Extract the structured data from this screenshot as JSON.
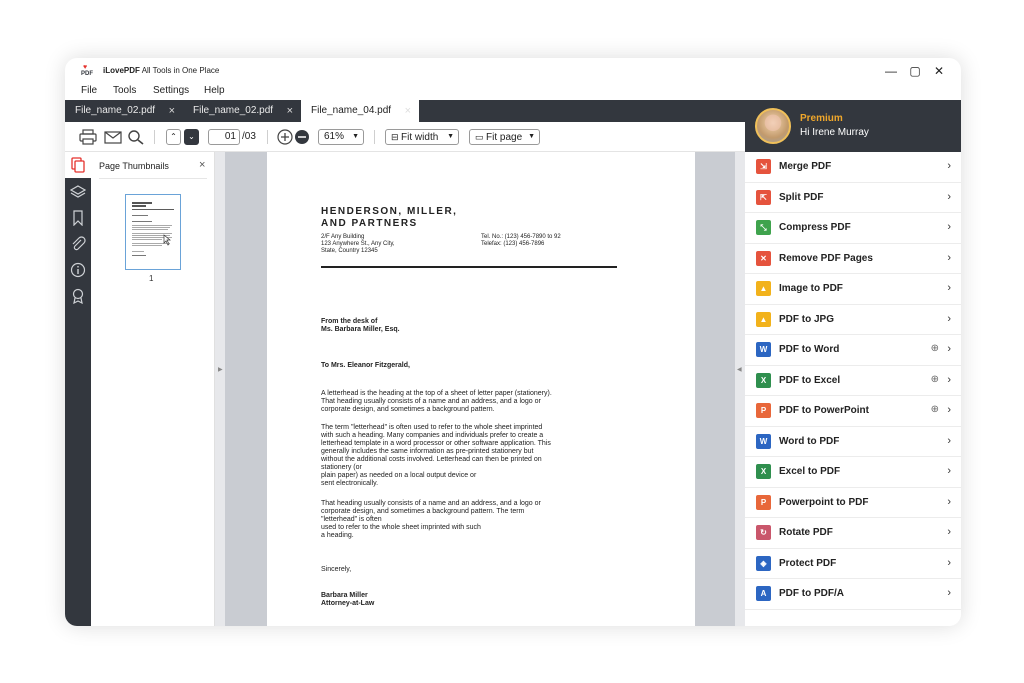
{
  "app": {
    "title_brand": "iLovePDF",
    "title_rest": " All Tools in One Place",
    "logo_text": "PDF"
  },
  "window": {
    "minimize": "—",
    "maximize": "▢",
    "close": "✕"
  },
  "menu": [
    "File",
    "Tools",
    "Settings",
    "Help"
  ],
  "tabs": [
    {
      "label": "File_name_02.pdf",
      "close": "×"
    },
    {
      "label": "File_name_02.pdf",
      "close": "×"
    },
    {
      "label": "File_name_04.pdf",
      "close": "×"
    }
  ],
  "toolbar": {
    "page_current": "01",
    "page_total": "/03",
    "zoom": "61%",
    "fit_width": "Fit width",
    "fit_page": "Fit page"
  },
  "thumbnails": {
    "title": "Page Thumbnails",
    "close": "×",
    "page_num": "1"
  },
  "document": {
    "company": "HENDERSON, MILLER,\nAND PARTNERS",
    "address": "2/F Any Building\n123 Anywhere St., Any City,\nState, Country 12345",
    "contact": "Tel. No.: (123) 456-7890 to 92\nTelefax: (123) 456-7896",
    "from": "From the desk of\nMs. Barbara Miller, Esq.",
    "to": "To Mrs. Eleanor Fitzgerald,",
    "p1": "A letterhead is the heading at the top of a sheet of letter paper (stationery).\nThat heading usually consists of a name and an address, and a logo or\ncorporate design, and sometimes a background pattern.",
    "p2": "The term \"letterhead\" is often used to refer to the whole sheet imprinted\nwith such a heading. Many companies and individuals prefer to create a\nletterhead template in a word processor or other software application. This\ngenerally includes the same information as pre-printed stationery but\nwithout the additional costs involved. Letterhead can then be printed on\nstationery (or\nplain paper) as needed on a local output device or\nsent electronically.",
    "p3": "That heading usually consists of a name and an address, and a logo or\ncorporate design, and sometimes a background pattern. The term\n\"letterhead\" is often\nused to refer to the whole sheet imprinted with such\na heading.",
    "closing": "Sincerely,",
    "signer": "Barbara Miller\nAttorney-at-Law"
  },
  "user": {
    "tier": "Premium",
    "greeting": "Hi Irene Murray"
  },
  "tools": [
    {
      "label": "Merge PDF",
      "color": "#e5533d",
      "glyph": "⇲",
      "globe": false
    },
    {
      "label": "Split PDF",
      "color": "#e5533d",
      "glyph": "⇱",
      "globe": false
    },
    {
      "label": "Compress PDF",
      "color": "#3fa34d",
      "glyph": "⤡",
      "globe": false
    },
    {
      "label": "Remove PDF Pages",
      "color": "#e5533d",
      "glyph": "✕",
      "globe": false
    },
    {
      "label": "Image to PDF",
      "color": "#f2b21b",
      "glyph": "▲",
      "globe": false
    },
    {
      "label": "PDF to JPG",
      "color": "#f2b21b",
      "glyph": "▲",
      "globe": false
    },
    {
      "label": "PDF to Word",
      "color": "#2c66c2",
      "glyph": "W",
      "globe": true
    },
    {
      "label": "PDF to Excel",
      "color": "#2f8f4e",
      "glyph": "X",
      "globe": true
    },
    {
      "label": "PDF to PowerPoint",
      "color": "#e8673a",
      "glyph": "P",
      "globe": true
    },
    {
      "label": "Word to PDF",
      "color": "#2c66c2",
      "glyph": "W",
      "globe": false
    },
    {
      "label": "Excel to PDF",
      "color": "#2f8f4e",
      "glyph": "X",
      "globe": false
    },
    {
      "label": "Powerpoint to PDF",
      "color": "#e8673a",
      "glyph": "P",
      "globe": false
    },
    {
      "label": "Rotate PDF",
      "color": "#c9566b",
      "glyph": "↻",
      "globe": false
    },
    {
      "label": "Protect PDF",
      "color": "#2c66c2",
      "glyph": "◈",
      "globe": false
    },
    {
      "label": "PDF to PDF/A",
      "color": "#2c66c2",
      "glyph": "A",
      "globe": false
    }
  ],
  "icons": {
    "chevron": "›",
    "globe": "⊕"
  }
}
